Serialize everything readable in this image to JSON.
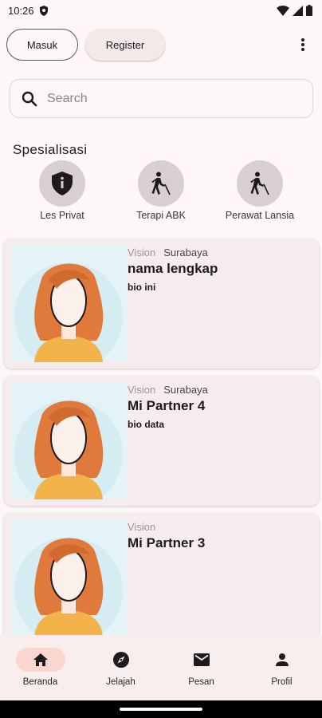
{
  "status_bar": {
    "time": "10:26"
  },
  "header": {
    "login_label": "Masuk",
    "register_label": "Register"
  },
  "search": {
    "placeholder": "Search"
  },
  "specializations": {
    "title": "Spesialisasi",
    "items": [
      {
        "label": "Les Privat",
        "icon": "shield-info-icon"
      },
      {
        "label": "Terapi ABK",
        "icon": "blind-person-icon"
      },
      {
        "label": "Perawat Lansia",
        "icon": "blind-person-icon"
      }
    ]
  },
  "partners": [
    {
      "category": "Vision",
      "city": "Surabaya",
      "name": "nama lengkap",
      "bio": "bio ini"
    },
    {
      "category": "Vision",
      "city": "Surabaya",
      "name": "Mi Partner 4",
      "bio": "bio data"
    },
    {
      "category": "Vision",
      "city": "",
      "name": "Mi Partner 3",
      "bio": ""
    }
  ],
  "bottom_nav": {
    "items": [
      {
        "label": "Beranda",
        "icon": "home-icon",
        "active": true
      },
      {
        "label": "Jelajah",
        "icon": "compass-icon",
        "active": false
      },
      {
        "label": "Pesan",
        "icon": "mail-icon",
        "active": false
      },
      {
        "label": "Profil",
        "icon": "person-icon",
        "active": false
      }
    ]
  },
  "colors": {
    "accent": "#fbd6cf",
    "card_bg": "#f6eced",
    "photo_bg": "#e3f3f7"
  }
}
